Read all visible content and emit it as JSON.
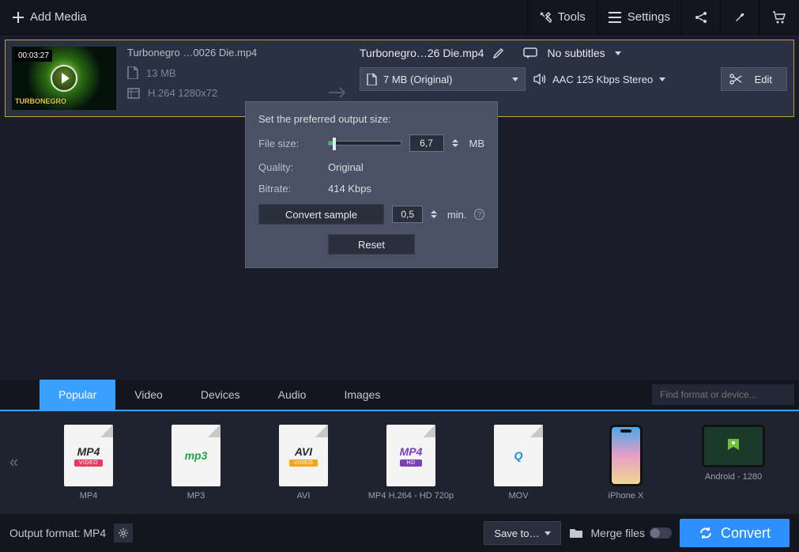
{
  "topbar": {
    "add_media": "Add Media",
    "tools": "Tools",
    "settings": "Settings"
  },
  "media": {
    "duration": "00:03:27",
    "src_filename": "Turbonegro  …0026 Die.mp4",
    "src_size": "13 MB",
    "src_codec": "H.264 1280x72",
    "out_filename": "Turbonegro…26 Die.mp4",
    "subtitles_label": "No subtitles",
    "format_label": "7 MB (Original)",
    "audio_label": "AAC 125 Kbps Stereo",
    "edit_label": "Edit"
  },
  "popover": {
    "title": "Set the preferred output size:",
    "filesize_label": "File size:",
    "filesize_value": "6,7",
    "filesize_unit": "MB",
    "quality_label": "Quality:",
    "quality_value": "Original",
    "bitrate_label": "Bitrate:",
    "bitrate_value": "414 Kbps",
    "convert_sample": "Convert sample",
    "sample_value": "0,5",
    "sample_unit": "min.",
    "reset": "Reset"
  },
  "tabs": [
    "Popular",
    "Video",
    "Devices",
    "Audio",
    "Images"
  ],
  "search_placeholder": "Find format or device...",
  "formats": [
    {
      "label": "MP4",
      "txt": "MP4",
      "txtcolor": "#2a2a2a",
      "strip": "VIDEO",
      "stripbg": "#e8395e"
    },
    {
      "label": "MP3",
      "txt": "mp3",
      "txtcolor": "#1aa84a",
      "strip": "",
      "stripbg": ""
    },
    {
      "label": "AVI",
      "txt": "AVI",
      "txtcolor": "#2a2a2a",
      "strip": "VIDEO",
      "stripbg": "#f0a818"
    },
    {
      "label": "MP4 H.264 - HD 720p",
      "txt": "MP4",
      "txtcolor": "#7b3fb8",
      "strip": "HD",
      "stripbg": "#7b3fb8"
    },
    {
      "label": "MOV",
      "txt": "Q",
      "txtcolor": "#1a88e8",
      "strip": "",
      "stripbg": ""
    },
    {
      "label": "iPhone X",
      "kind": "phone"
    },
    {
      "label": "Android - 1280",
      "kind": "tablet"
    }
  ],
  "bottom": {
    "output_format": "Output format: MP4",
    "save_to": "Save to…",
    "merge_files": "Merge files",
    "convert": "Convert"
  }
}
